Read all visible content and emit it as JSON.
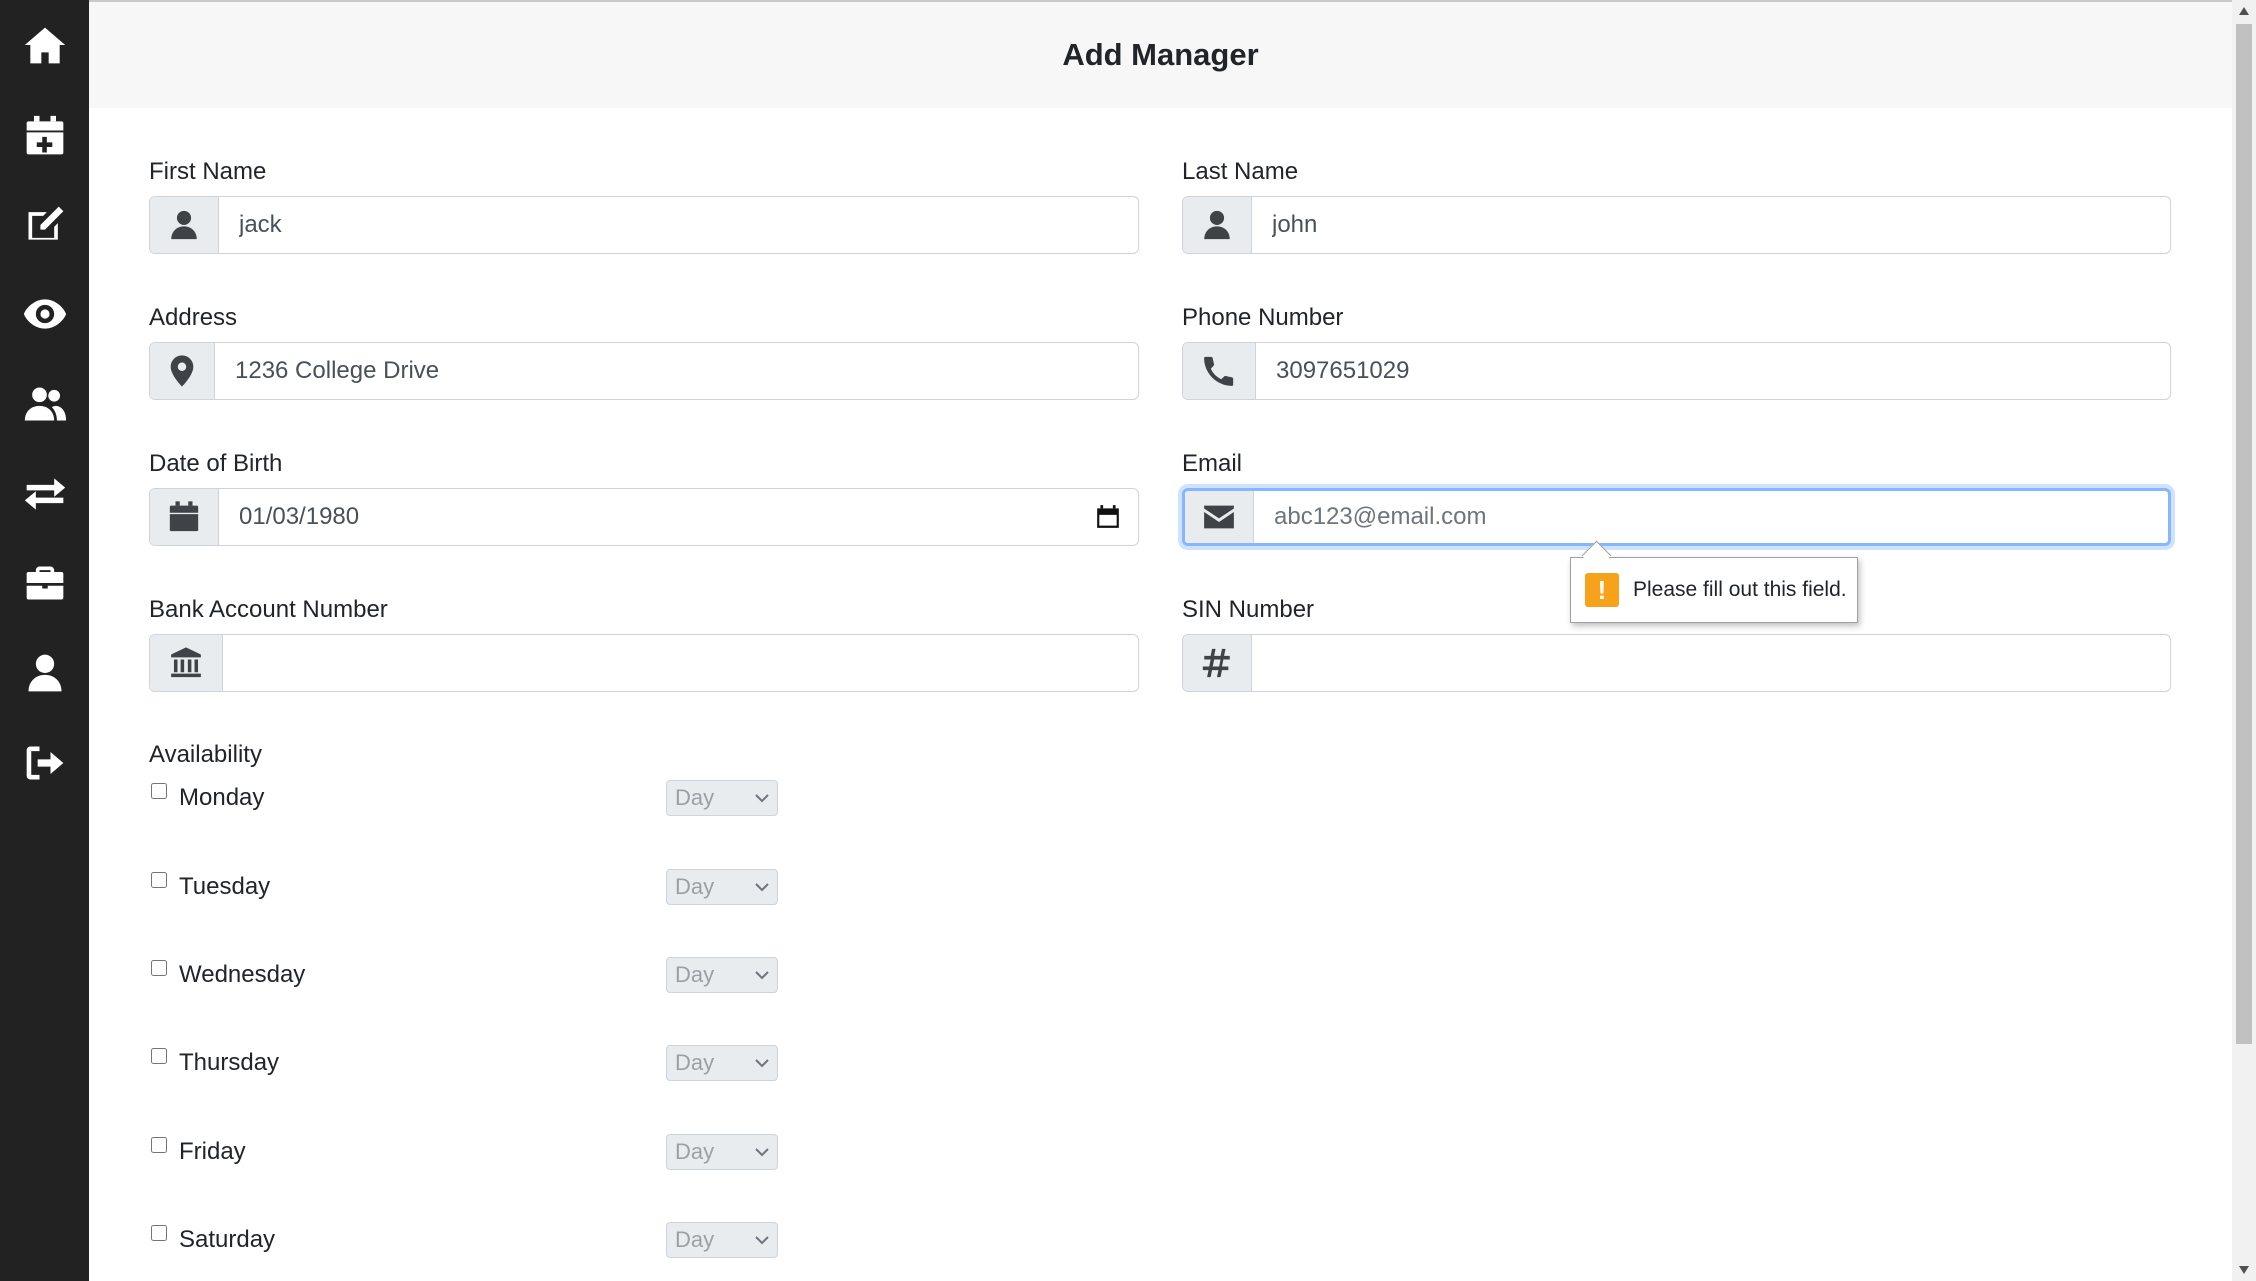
{
  "header": {
    "title": "Add Manager"
  },
  "sidebar": {
    "items": [
      {
        "icon": "home-icon"
      },
      {
        "icon": "calendar-plus-icon"
      },
      {
        "icon": "edit-icon"
      },
      {
        "icon": "eye-icon"
      },
      {
        "icon": "users-icon"
      },
      {
        "icon": "exchange-icon"
      },
      {
        "icon": "briefcase-icon"
      },
      {
        "icon": "user-icon"
      },
      {
        "icon": "sign-out-icon"
      }
    ]
  },
  "form": {
    "first_name": {
      "label": "First Name",
      "value": "jack",
      "icon": "user-icon"
    },
    "last_name": {
      "label": "Last Name",
      "value": "john",
      "icon": "user-icon"
    },
    "address": {
      "label": "Address",
      "value": "1236 College Drive",
      "icon": "map-marker-icon"
    },
    "phone": {
      "label": "Phone Number",
      "value": "3097651029",
      "icon": "phone-icon"
    },
    "dob": {
      "label": "Date of Birth",
      "value": "01/03/1980",
      "icon": "calendar-icon"
    },
    "email": {
      "label": "Email",
      "value": "",
      "placeholder": "abc123@email.com",
      "icon": "envelope-icon"
    },
    "bank": {
      "label": "Bank Account Number",
      "value": "",
      "icon": "bank-icon"
    },
    "sin": {
      "label": "SIN Number",
      "value": "",
      "icon": "hashtag-icon"
    }
  },
  "validation": {
    "message": "Please fill out this field."
  },
  "availability": {
    "title": "Availability",
    "days": [
      {
        "label": "Monday",
        "select": "Day"
      },
      {
        "label": "Tuesday",
        "select": "Day"
      },
      {
        "label": "Wednesday",
        "select": "Day"
      },
      {
        "label": "Thursday",
        "select": "Day"
      },
      {
        "label": "Friday",
        "select": "Day"
      },
      {
        "label": "Saturday",
        "select": "Day"
      }
    ]
  }
}
